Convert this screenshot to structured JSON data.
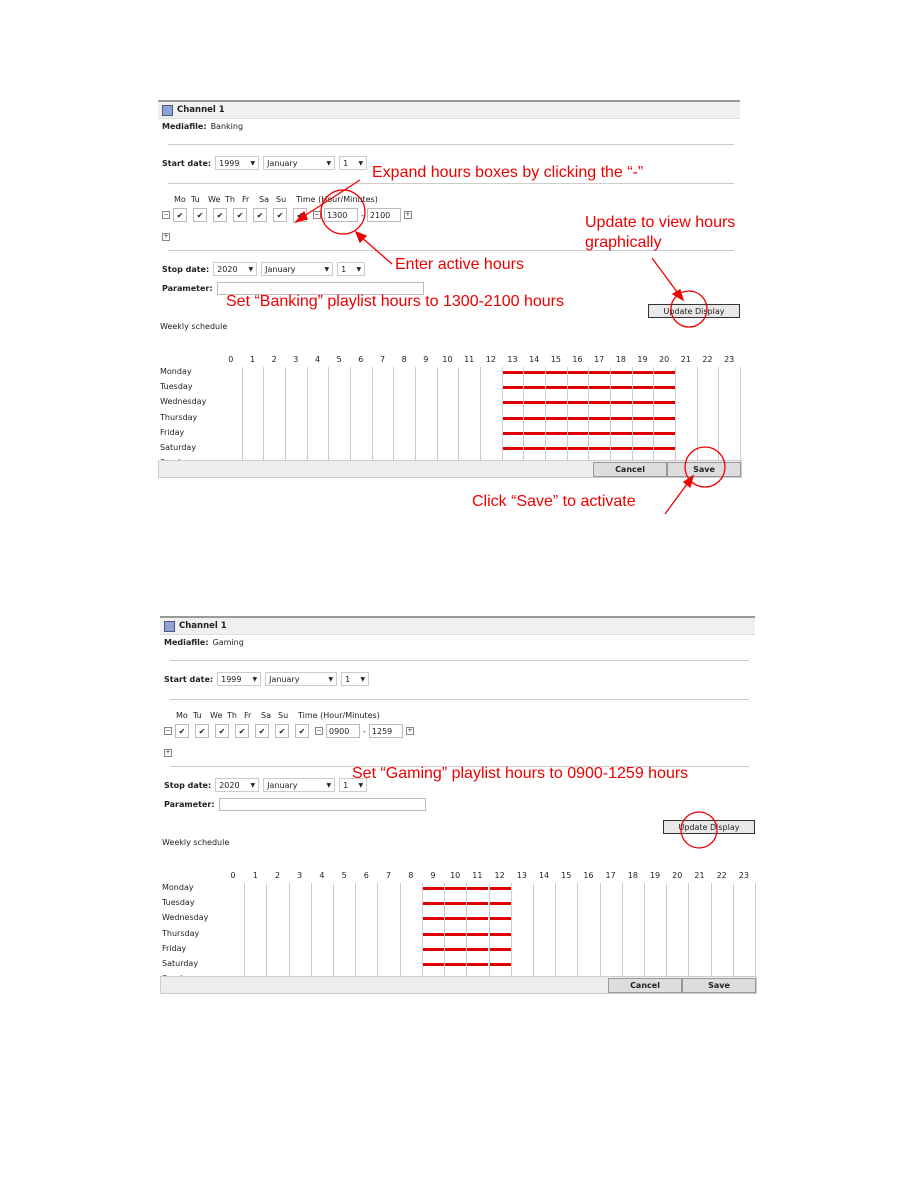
{
  "panels": [
    {
      "title": "Channel 1",
      "mediafile_label": "Mediafile:",
      "mediafile": "Banking",
      "start_label": "Start date:",
      "start_year": "1999",
      "start_month": "January",
      "start_day": "1",
      "days": [
        "Mo",
        "Tu",
        "We",
        "Th",
        "Fr",
        "Sa",
        "Su"
      ],
      "time_label": "Time (Hour/Minutes)",
      "days_checked": [
        true,
        true,
        true,
        true,
        true,
        true,
        true
      ],
      "time_from": "1300",
      "time_sep": "-",
      "time_to": "2100",
      "stop_label": "Stop date:",
      "stop_year": "2020",
      "stop_month": "January",
      "stop_day": "1",
      "parameter_label": "Parameter:",
      "parameter_value": "",
      "update_label": "Update Display",
      "weekly_label": "Weekly schedule",
      "hours": [
        "0",
        "1",
        "2",
        "3",
        "4",
        "5",
        "6",
        "7",
        "8",
        "9",
        "10",
        "11",
        "12",
        "13",
        "14",
        "15",
        "16",
        "17",
        "18",
        "19",
        "20",
        "21",
        "22",
        "23"
      ],
      "weekdays": [
        "Monday",
        "Tuesday",
        "Wednesday",
        "Thursday",
        "Friday",
        "Saturday",
        "Sunday"
      ],
      "active_start_hour": 13,
      "active_end_hour": 21,
      "cancel_label": "Cancel",
      "save_label": "Save"
    },
    {
      "title": "Channel 1",
      "mediafile_label": "Mediafile:",
      "mediafile": "Gaming",
      "start_label": "Start date:",
      "start_year": "1999",
      "start_month": "January",
      "start_day": "1",
      "days": [
        "Mo",
        "Tu",
        "We",
        "Th",
        "Fr",
        "Sa",
        "Su"
      ],
      "time_label": "Time (Hour/Minutes)",
      "days_checked": [
        true,
        true,
        true,
        true,
        true,
        true,
        true
      ],
      "time_from": "0900",
      "time_sep": "-",
      "time_to": "1259",
      "stop_label": "Stop date:",
      "stop_year": "2020",
      "stop_month": "January",
      "stop_day": "1",
      "parameter_label": "Parameter:",
      "parameter_value": "",
      "update_label": "Update Display",
      "weekly_label": "Weekly schedule",
      "hours": [
        "0",
        "1",
        "2",
        "3",
        "4",
        "5",
        "6",
        "7",
        "8",
        "9",
        "10",
        "11",
        "12",
        "13",
        "14",
        "15",
        "16",
        "17",
        "18",
        "19",
        "20",
        "21",
        "22",
        "23"
      ],
      "weekdays": [
        "Monday",
        "Tuesday",
        "Wednesday",
        "Thursday",
        "Friday",
        "Saturday",
        "Sunday"
      ],
      "active_start_hour": 9,
      "active_end_hour": 13,
      "cancel_label": "Cancel",
      "save_label": "Save"
    }
  ],
  "annotations": {
    "expand": "Expand hours boxes by clicking the “-”",
    "update": "Update to view hours",
    "update2": "graphically",
    "enter": "Enter active hours",
    "banking": "Set “Banking” playlist hours to 1300-2100 hours",
    "save": "Click “Save” to activate",
    "gaming": "Set “Gaming” playlist hours to 0900-1259 hours"
  },
  "colors": {
    "accent": "#e00000",
    "schedule_bar": "#e00000"
  }
}
